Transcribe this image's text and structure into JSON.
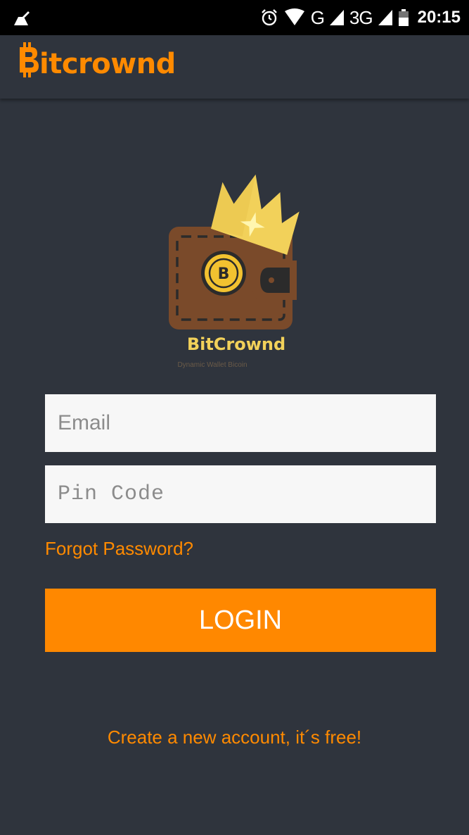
{
  "status_bar": {
    "network_1": "G",
    "network_2": "3G",
    "time": "20:15"
  },
  "app_bar": {
    "brand_rest": "itcrownd"
  },
  "logo": {
    "name": "BitCrownd",
    "tagline": "Dynamic Wallet Bicoin"
  },
  "form": {
    "email_placeholder": "Email",
    "pin_placeholder": "Pin Code",
    "forgot_label": "Forgot Password?",
    "login_label": "LOGIN",
    "create_label": "Create a new account, it´s free!"
  },
  "colors": {
    "accent": "#ff8800",
    "background": "#2f343d",
    "wallet": "#7a4a2a",
    "crown": "#f2d15a"
  },
  "icons": [
    "cleaner-icon",
    "alarm-icon",
    "wifi-icon",
    "signal-icon",
    "battery-icon",
    "bitcoin-icon",
    "crown-icon",
    "wallet-icon"
  ]
}
